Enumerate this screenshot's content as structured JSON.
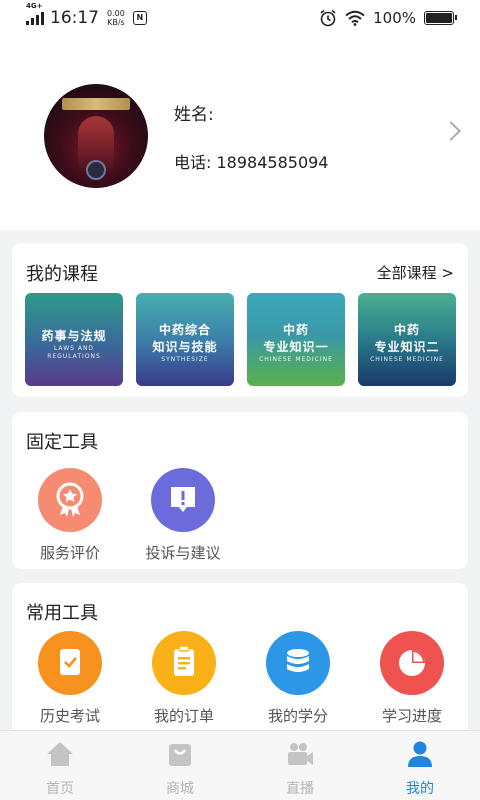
{
  "status_bar": {
    "network": "4G+",
    "time": "16:17",
    "speed_value": "0.00",
    "speed_unit": "KB/s",
    "battery": "100%",
    "battery_level": 1.0
  },
  "profile": {
    "name_label": "姓名:",
    "phone_label": "电话:",
    "phone": "18984585094"
  },
  "my_courses": {
    "title": "我的课程",
    "all_link": "全部课程 >",
    "items": [
      {
        "title": "药事与法规",
        "subtitle": "LAWS AND REGULATIONS"
      },
      {
        "title_line1": "中药综合",
        "title_line2": "知识与技能",
        "subtitle": "SYNTHESIZE"
      },
      {
        "title_line1": "中药",
        "title_line2": "专业知识一",
        "subtitle": "CHINESE MEDICINE"
      },
      {
        "title_line1": "中药",
        "title_line2": "专业知识二",
        "subtitle": "CHINESE MEDICINE"
      }
    ]
  },
  "fixed_tools": {
    "title": "固定工具",
    "items": [
      {
        "label": "服务评价",
        "icon": "medal-icon",
        "color": "#f58c72"
      },
      {
        "label": "投诉与建议",
        "icon": "feedback-icon",
        "color": "#6b6bdc"
      }
    ]
  },
  "common_tools": {
    "title": "常用工具",
    "items": [
      {
        "label": "历史考试",
        "icon": "exam-icon",
        "color": "#f7921e"
      },
      {
        "label": "我的订单",
        "icon": "order-icon",
        "color": "#fbb01a"
      },
      {
        "label": "我的学分",
        "icon": "credits-icon",
        "color": "#2b97e6"
      },
      {
        "label": "学习进度",
        "icon": "progress-icon",
        "color": "#ef5350"
      }
    ]
  },
  "tabbar": {
    "items": [
      {
        "label": "首页",
        "icon": "home-icon",
        "active": false
      },
      {
        "label": "商城",
        "icon": "shop-icon",
        "active": false
      },
      {
        "label": "直播",
        "icon": "live-icon",
        "active": false
      },
      {
        "label": "我的",
        "icon": "profile-icon",
        "active": true
      }
    ],
    "active_color": "#1d86e0",
    "inactive_color": "#b5b5b5"
  }
}
